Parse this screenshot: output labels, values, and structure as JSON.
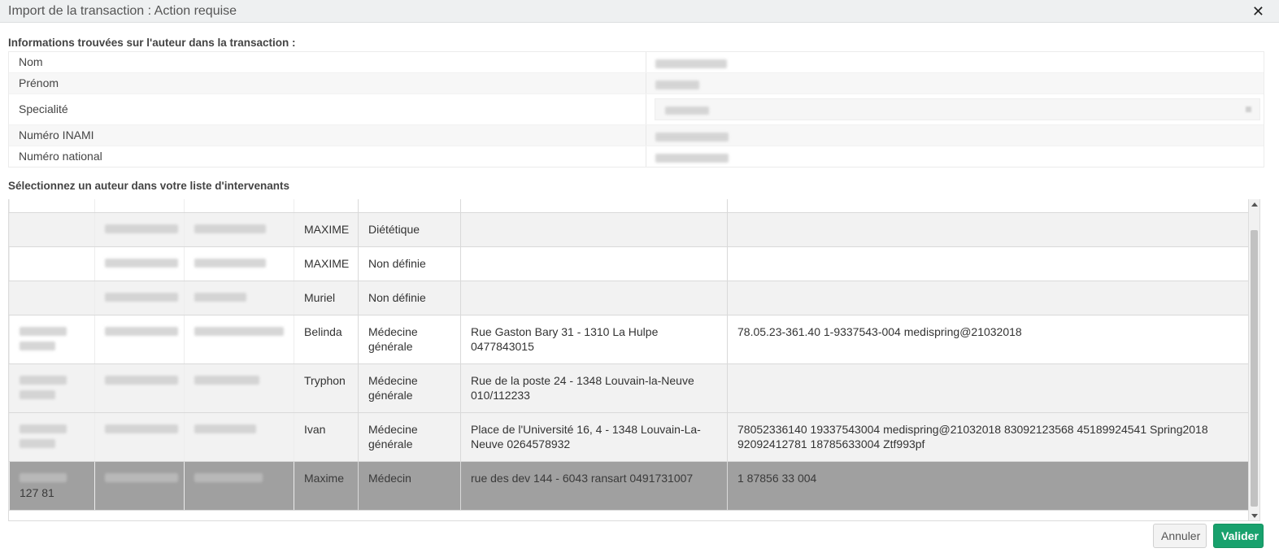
{
  "dialog": {
    "title": "Import de la transaction : Action requise",
    "close_label": "✕"
  },
  "info_section": {
    "heading": "Informations trouvées sur l'auteur dans la transaction :",
    "rows": [
      {
        "label": "Nom"
      },
      {
        "label": "Prénom"
      },
      {
        "label": "Specialité"
      },
      {
        "label": "Numéro INAMI"
      },
      {
        "label": "Numéro national"
      }
    ]
  },
  "select_section": {
    "heading": "Sélectionnez un auteur dans votre liste d'intervenants"
  },
  "grid": {
    "rows": [
      {
        "firstname": "MAXIME",
        "specialty": "Diététique",
        "address": "",
        "info": ""
      },
      {
        "firstname": "MAXIME",
        "specialty": "Non définie",
        "address": "",
        "info": ""
      },
      {
        "firstname": "Muriel",
        "specialty": "Non définie",
        "address": "",
        "info": ""
      },
      {
        "firstname": "Belinda",
        "specialty": "Médecine générale",
        "address": "Rue Gaston Bary 31 - 1310 La Hulpe 0477843015",
        "info": "78.05.23-361.40 1-9337543-004 medispring@21032018"
      },
      {
        "firstname": "Tryphon",
        "specialty": "Médecine générale",
        "address": "Rue de la poste 24 - 1348 Louvain-la-Neuve 010/112233",
        "info": ""
      },
      {
        "firstname": "Ivan",
        "specialty": "Médecine générale",
        "address": "Place de l'Université 16, 4 - 1348 Louvain-La-Neuve 0264578932",
        "info": "78052336140 19337543004 medispring@21032018 83092123568 45189924541 Spring2018 92092412781 18785633004 Ztf993pf"
      },
      {
        "firstname": "Maxime",
        "specialty": "Médecin",
        "address": "rue des dev 144 - 6043 ransart 0491731007",
        "info": "1 87856 33 004",
        "col_a_visible": "127 81"
      }
    ]
  },
  "buttons": {
    "cancel": "Annuler",
    "validate": "Valider"
  },
  "colors": {
    "validate_bg": "#18a16d",
    "selected_row_bg": "#a0a0a0",
    "titlebar_bg": "#eef0f1"
  }
}
